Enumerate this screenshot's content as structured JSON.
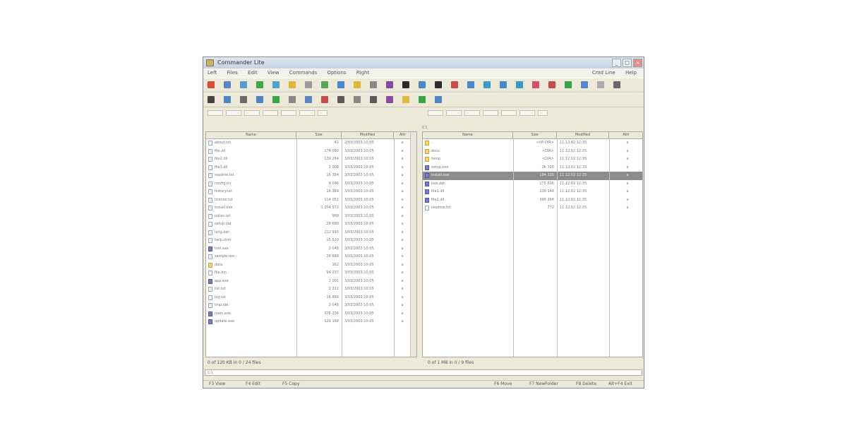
{
  "window": {
    "title": "Commander Lite",
    "minimize": "_",
    "maximize": "□",
    "close": "×"
  },
  "menu": {
    "items": [
      "Left",
      "Files",
      "Edit",
      "View",
      "Commands",
      "Options",
      "Right"
    ],
    "right_items": [
      "Cmd Line",
      "Help"
    ]
  },
  "toolbar1_colors": [
    "#d84b3c",
    "#5a86c9",
    "#5a9ac9",
    "#3aa34a",
    "#4aa3c9",
    "#e0b83a",
    "#9a9a9a",
    "#5aa35a",
    "#4a86c9",
    "#e0b83a",
    "#888",
    "#8a4aa3",
    "#2a2a2a",
    "#4a86c9",
    "#2a2a2a",
    "#c94a4a",
    "#4a86c9",
    "#3a9ac9",
    "#4a86c9",
    "#3a9ac9",
    "#d84b6a",
    "#c94a4a",
    "#3aa34a",
    "#5a86c9",
    "#aaaaaa",
    "#6a6a6a"
  ],
  "toolbar2_colors": [
    "#444",
    "#4a86c9",
    "#6a6a6a",
    "#4a86c9",
    "#3aa34a",
    "#888",
    "#5a86c9",
    "#c94a4a",
    "#5a5a5a",
    "#888",
    "#5a5a5a",
    "#8a4aa3",
    "#e0b83a",
    "#3aa34a",
    "#4a86c9"
  ],
  "left_panel": {
    "columns": [
      "Name",
      "Size",
      "Modified",
      "Attr"
    ],
    "rows": [
      {
        "icon": "file",
        "name": "about.txt",
        "size": "42",
        "date": "2/03/2003 10:05",
        "attr": "a"
      },
      {
        "icon": "file",
        "name": "file.dll",
        "size": "174 080",
        "date": "3/03/2003 10:05",
        "attr": "a"
      },
      {
        "icon": "file",
        "name": "file2.dll",
        "size": "139 264",
        "date": "3/03/2003 10:05",
        "attr": "a"
      },
      {
        "icon": "file",
        "name": "file3.dll",
        "size": "1 008",
        "date": "3/03/2003 10:05",
        "attr": "a"
      },
      {
        "icon": "file",
        "name": "readme.txt",
        "size": "16 384",
        "date": "3/03/2003 10:05",
        "attr": "a"
      },
      {
        "icon": "file",
        "name": "config.ini",
        "size": "4 096",
        "date": "3/03/2003 10:05",
        "attr": "a"
      },
      {
        "icon": "file",
        "name": "history.txt",
        "size": "16 384",
        "date": "3/03/2003 10:05",
        "attr": "a"
      },
      {
        "icon": "file",
        "name": "license.txt",
        "size": "114 052",
        "date": "3/03/2003 10:05",
        "attr": "a"
      },
      {
        "icon": "file",
        "name": "install.exe",
        "size": "1 254 572",
        "date": "3/03/2003 10:05",
        "attr": "a"
      },
      {
        "icon": "file",
        "name": "notes.txt",
        "size": "968",
        "date": "3/03/2003 10:05",
        "attr": "a"
      },
      {
        "icon": "file",
        "name": "setup.dat",
        "size": "28 688",
        "date": "3/03/2003 10:05",
        "attr": "a"
      },
      {
        "icon": "file",
        "name": "lang.dat",
        "size": "212 993",
        "date": "3/03/2003 10:05",
        "attr": "a"
      },
      {
        "icon": "file",
        "name": "help.chm",
        "size": "15 520",
        "date": "3/03/2003 10:05",
        "attr": "a"
      },
      {
        "icon": "exe",
        "name": "tool.exe",
        "size": "2 048",
        "date": "3/03/2003 10:05",
        "attr": "a"
      },
      {
        "icon": "file",
        "name": "sample.doc",
        "size": "28 688",
        "date": "3/03/2003 10:05",
        "attr": "a"
      },
      {
        "icon": "folder",
        "name": "data",
        "size": "162",
        "date": "3/03/2003 10:05",
        "attr": "a"
      },
      {
        "icon": "file",
        "name": "file.bin",
        "size": "94 237",
        "date": "3/03/2003 10:05",
        "attr": "a"
      },
      {
        "icon": "exe",
        "name": "app.exe",
        "size": "1 001",
        "date": "3/03/2003 10:05",
        "attr": "a"
      },
      {
        "icon": "file",
        "name": "list.txt",
        "size": "2 212",
        "date": "3/03/2003 10:05",
        "attr": "a"
      },
      {
        "icon": "file",
        "name": "log.txt",
        "size": "16 866",
        "date": "3/03/2003 10:05",
        "attr": "a"
      },
      {
        "icon": "file",
        "name": "tmp.dat",
        "size": "2 048",
        "date": "3/03/2003 10:05",
        "attr": "a"
      },
      {
        "icon": "exe",
        "name": "main.exe",
        "size": "376 256",
        "date": "3/03/2003 10:05",
        "attr": "a"
      },
      {
        "icon": "exe",
        "name": "update.exe",
        "size": "129 168",
        "date": "3/03/2003 10:05",
        "attr": "a"
      }
    ]
  },
  "right_panel": {
    "path": "c:\\",
    "columns": [
      "Name",
      "Size",
      "Modified",
      "Attr"
    ],
    "rows": [
      {
        "icon": "folder",
        "name": "..",
        "size": "<UP-DIR>",
        "date": "11.12.02 12:35",
        "attr": "a"
      },
      {
        "icon": "folder",
        "name": "docs",
        "size": "<DIR>",
        "date": "11.12.02 12:35",
        "attr": "a"
      },
      {
        "icon": "folder",
        "name": "temp",
        "size": "<DIR>",
        "date": "11.12.02 12:35",
        "attr": "a"
      },
      {
        "icon": "exe",
        "name": "setup.exe",
        "size": "26 716",
        "date": "11.12.02 12:35",
        "attr": "a"
      },
      {
        "icon": "exe",
        "name": "install.exe",
        "size": "184 320",
        "date": "11.12.02 12:35",
        "attr": "a",
        "selected": true
      },
      {
        "icon": "exe",
        "name": "tool.dat",
        "size": "175 616",
        "date": "11.12.02 12:35",
        "attr": "a"
      },
      {
        "icon": "exe",
        "name": "file1.dll",
        "size": "230 144",
        "date": "11.12.02 12:35",
        "attr": "a"
      },
      {
        "icon": "exe",
        "name": "file2.dll",
        "size": "395 264",
        "date": "11.12.02 12:35",
        "attr": "a"
      },
      {
        "icon": "file",
        "name": "readme.txt",
        "size": "772",
        "date": "11.12.02 12:35",
        "attr": "a"
      }
    ]
  },
  "status_left": "0 of 120 KB in 0 / 24 files",
  "status_right": "0 of 1 MB in 0 / 9 files",
  "cmd_path": "c:\\",
  "bottom_bar": [
    "F3 View",
    "F4 Edit",
    "F5 Copy",
    "F6 Move",
    "F7 NewFolder",
    "F8 Delete",
    "Alt+F4 Exit"
  ]
}
